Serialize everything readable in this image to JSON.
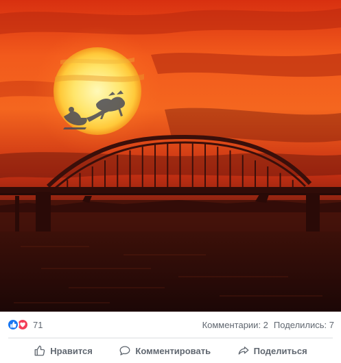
{
  "post": {
    "image": {
      "description_icon": "sunset-bridge-photo",
      "colors": {
        "sky_top": "#e8401a",
        "sky_mid": "#f86a1f",
        "sun": "#ffe873",
        "bridge": "#3a120c",
        "water": "#2a0c08"
      }
    },
    "reactions": {
      "icons": [
        "like-icon",
        "love-icon"
      ],
      "count": "71"
    },
    "stats": {
      "comments": "Комментарии: 2",
      "shares": "Поделились: 7"
    },
    "actions": {
      "like_label": "Нравится",
      "comment_label": "Комментировать",
      "share_label": "Поделиться"
    }
  }
}
